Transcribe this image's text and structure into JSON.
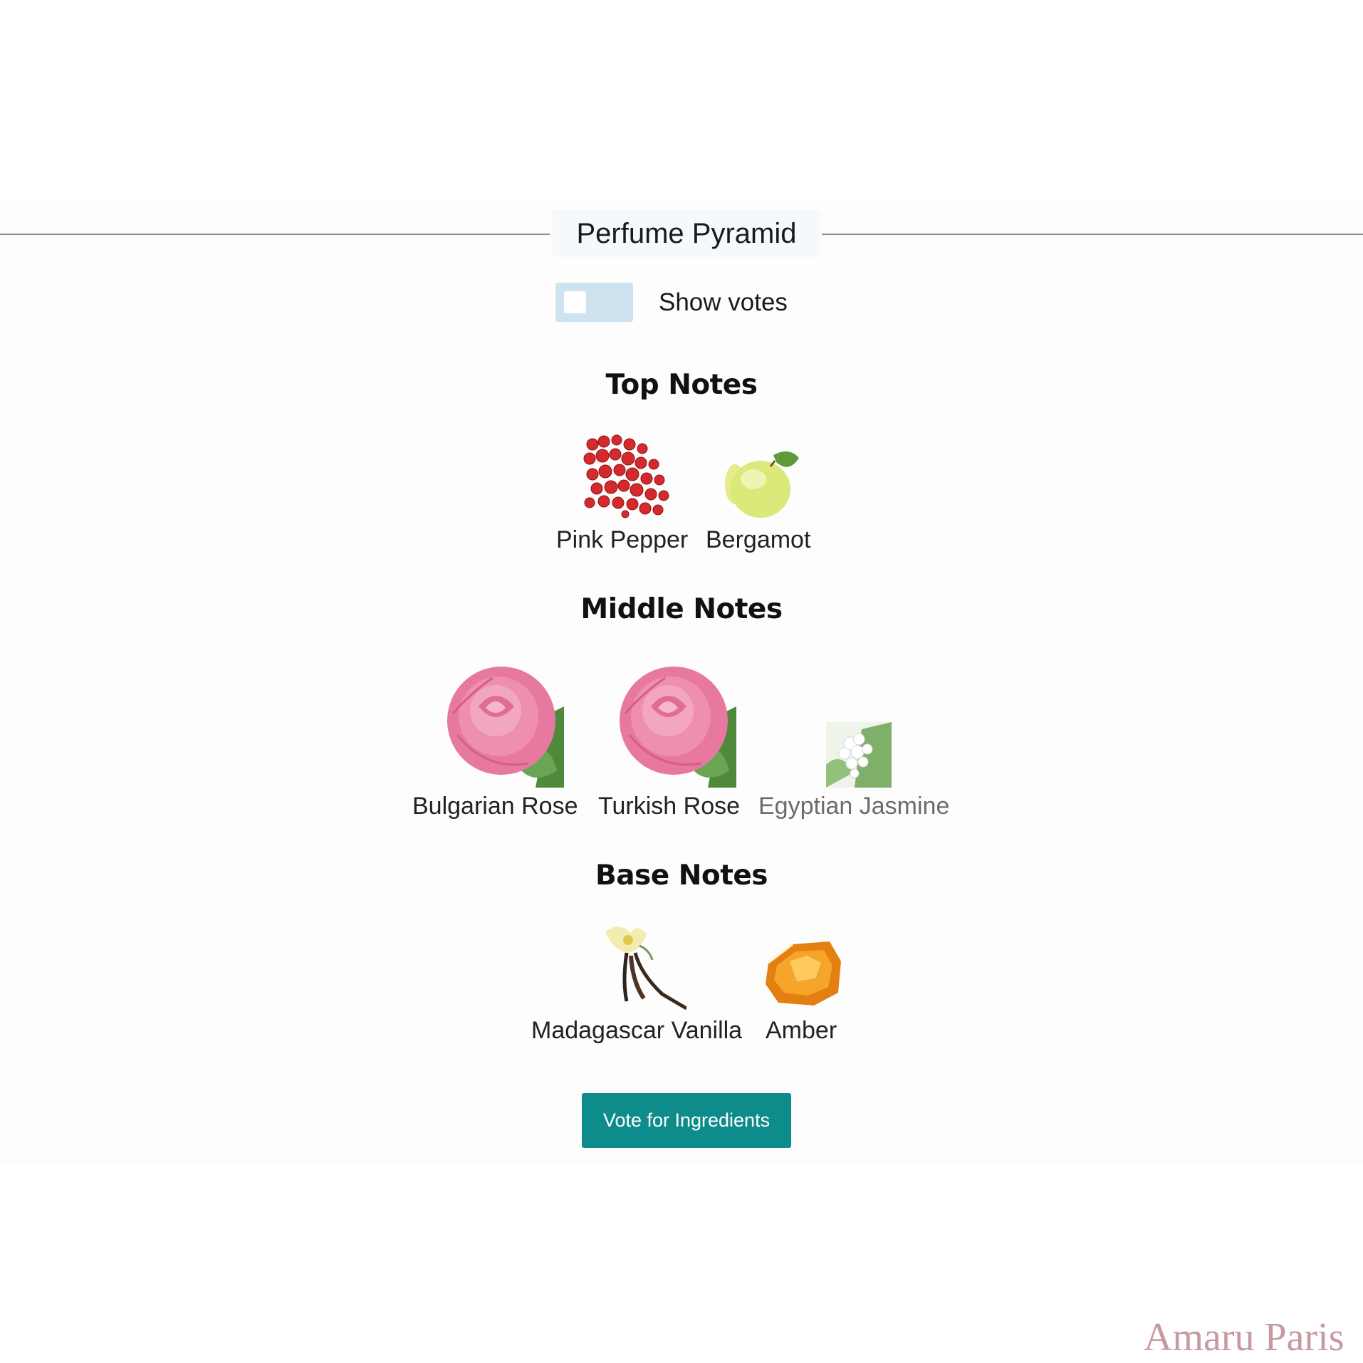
{
  "header": {
    "title": "Perfume Pyramid"
  },
  "toggle": {
    "label": "Show votes",
    "state": "off"
  },
  "sections": {
    "top": {
      "title": "Top Notes",
      "items": [
        {
          "label": "Pink Pepper",
          "icon": "pink-pepper-icon"
        },
        {
          "label": "Bergamot",
          "icon": "bergamot-icon"
        }
      ]
    },
    "middle": {
      "title": "Middle Notes",
      "items": [
        {
          "label": "Bulgarian Rose",
          "icon": "rose-icon"
        },
        {
          "label": "Turkish Rose",
          "icon": "rose-icon"
        },
        {
          "label": "Egyptian Jasmine",
          "icon": "jasmine-icon"
        }
      ]
    },
    "base": {
      "title": "Base Notes",
      "items": [
        {
          "label": "Madagascar Vanilla",
          "icon": "vanilla-icon"
        },
        {
          "label": "Amber",
          "icon": "amber-icon"
        }
      ]
    }
  },
  "button": {
    "label": "Vote for Ingredients"
  },
  "watermark": {
    "text": "Amaru Paris"
  },
  "colors": {
    "accent": "#0e8c8c",
    "toggle_off": "#cfe2f0",
    "watermark": "#c69aa1"
  }
}
